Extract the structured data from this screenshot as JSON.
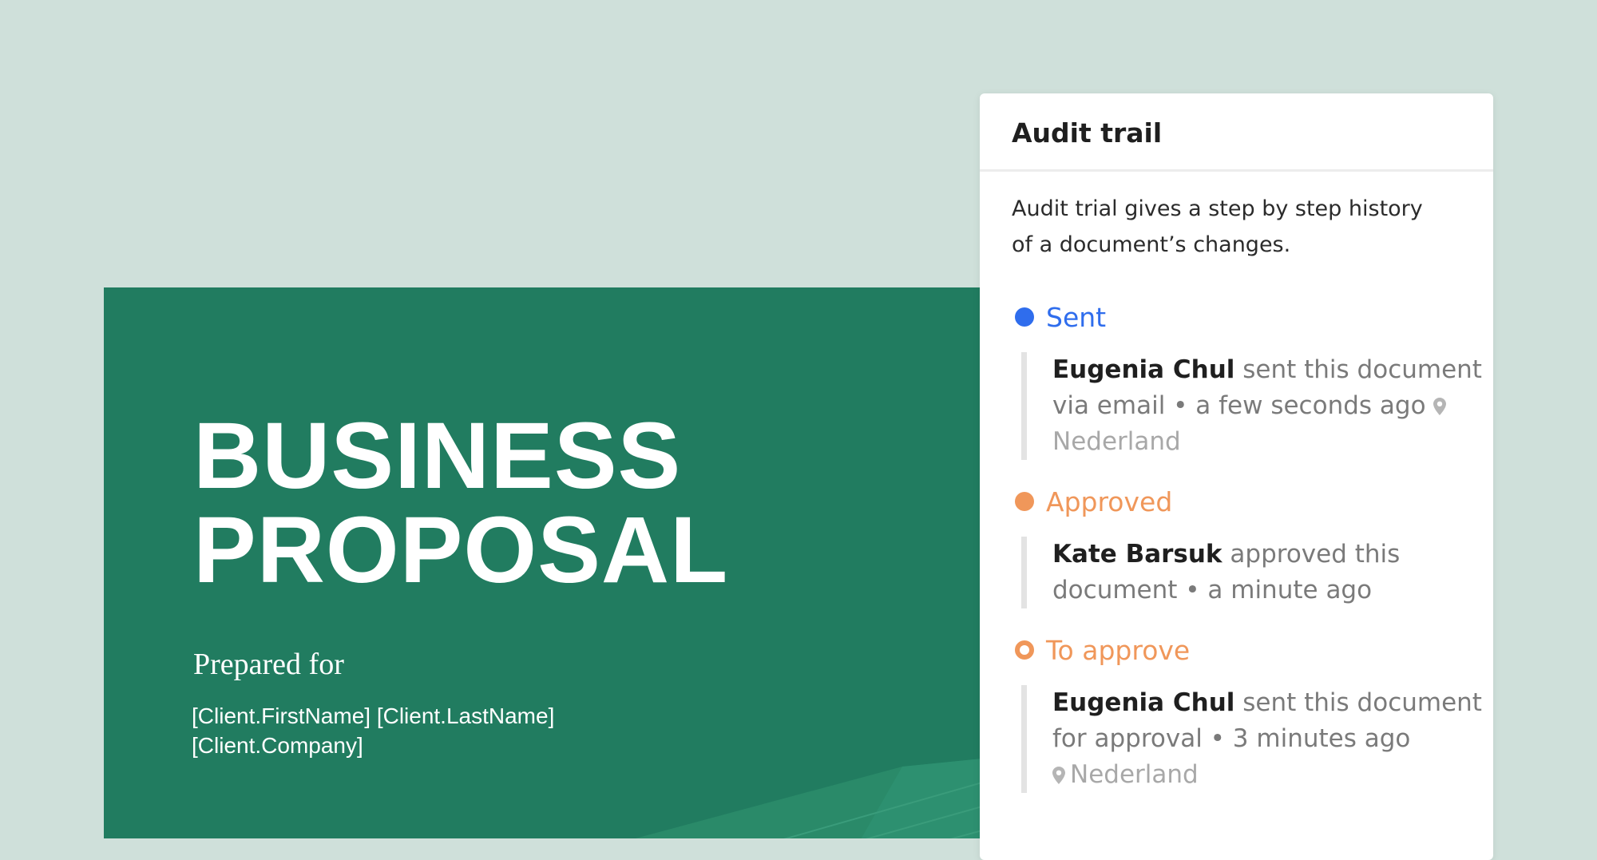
{
  "document": {
    "title_line1": "BUSINESS",
    "title_line2": "PROPOSAL",
    "prepared_for": "Prepared for",
    "client_name": "[Client.FirstName] [Client.LastName]",
    "client_company": "[Client.Company]",
    "background_color": "#217c60"
  },
  "audit_panel": {
    "title": "Audit trail",
    "description": "Audit trial gives a step by step history of a document’s changes.",
    "events": [
      {
        "status": "Sent",
        "status_color": "#2f6ded",
        "marker": "filled-dot",
        "actor": "Eugenia Chul",
        "action": " sent this document via email • a few seconds ago",
        "location": "Nederland",
        "location_icon": "map-pin-icon"
      },
      {
        "status": "Approved",
        "status_color": "#f0975a",
        "marker": "filled-dot",
        "actor": "Kate Barsuk",
        "action": " approved this document • a minute ago"
      },
      {
        "status": "To approve",
        "status_color": "#f0975a",
        "marker": "ring-dot",
        "actor": "Eugenia Chul",
        "action": " sent this document for approval • 3 minutes ago",
        "location": "Nederland",
        "location_icon": "map-pin-icon"
      }
    ]
  }
}
